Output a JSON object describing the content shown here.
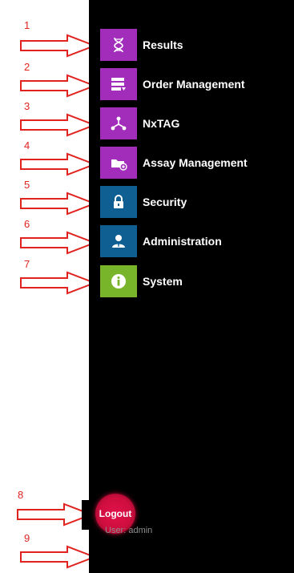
{
  "nav": {
    "items": [
      {
        "label": "Results",
        "icon": "dna-icon",
        "color": "#a22dbb",
        "marker": "1"
      },
      {
        "label": "Order Management",
        "icon": "order-list-icon",
        "color": "#a22dbb",
        "marker": "2"
      },
      {
        "label": "NxTAG",
        "icon": "molecule-icon",
        "color": "#a22dbb",
        "marker": "3"
      },
      {
        "label": "Assay Management",
        "icon": "assay-box-icon",
        "color": "#a22dbb",
        "marker": "4"
      },
      {
        "label": "Security",
        "icon": "lock-icon",
        "color": "#0f5f93",
        "marker": "5"
      },
      {
        "label": "Administration",
        "icon": "admin-user-icon",
        "color": "#0f5f93",
        "marker": "6"
      },
      {
        "label": "System",
        "icon": "info-icon",
        "color": "#79b52b",
        "marker": "7"
      }
    ]
  },
  "logout": {
    "label": "Logout",
    "marker": "8"
  },
  "user": {
    "text": "User:  admin",
    "marker": "9"
  },
  "colors": {
    "annotation": "#e0231f",
    "logout": "#d0103f"
  }
}
